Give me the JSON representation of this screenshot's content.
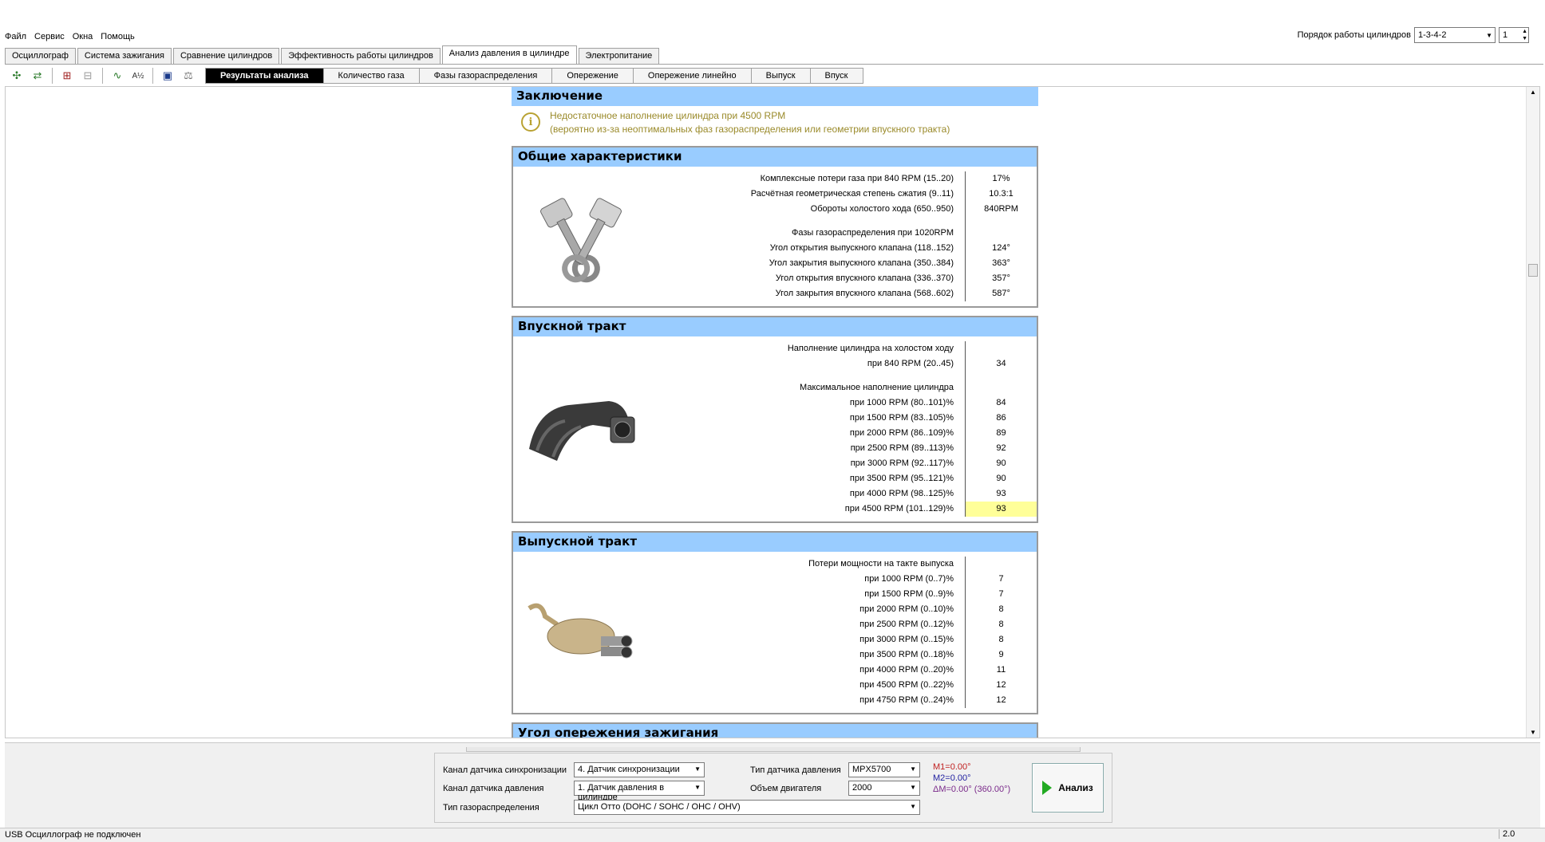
{
  "menu": [
    "Файл",
    "Сервис",
    "Окна",
    "Помощь"
  ],
  "cylinder_order": {
    "label": "Порядок работы цилиндров",
    "value": "1-3-4-2",
    "spinner": "1"
  },
  "tabs": [
    "Осциллограф",
    "Система зажигания",
    "Сравнение цилиндров",
    "Эффективность работы цилиндров",
    "Анализ давления в цилиндре",
    "Электропитание"
  ],
  "active_tab": "Анализ давления в цилиндре",
  "subtabs": [
    "Результаты анализа",
    "Количество газа",
    "Фазы газораспределения",
    "Опережение",
    "Опережение линейно",
    "Выпуск",
    "Впуск"
  ],
  "conclusion": {
    "title": "Заключение",
    "line1": "Недостаточное наполнение цилиндра при 4500 RPM",
    "line2": "(вероятно из-за неоптимальных фаз газораспределения или геометрии впускного тракта)"
  },
  "general": {
    "title": "Общие характеристики",
    "rows": [
      {
        "label": "Комплексные потери газа при 840 RPM (15..20)",
        "value": "17%"
      },
      {
        "label": "Расчётная геометрическая степень сжатия (9..11)",
        "value": "10.3:1"
      },
      {
        "label": "Обороты холостого хода (650..950)",
        "value": "840RPM"
      },
      {
        "label": "",
        "value": ""
      },
      {
        "label": "Фазы газораспределения при 1020RPM",
        "value": ""
      },
      {
        "label": "Угол открытия выпускного клапана (118..152)",
        "value": "124°"
      },
      {
        "label": "Угол закрытия выпускного клапана (350..384)",
        "value": "363°"
      },
      {
        "label": "Угол открытия впускного клапана (336..370)",
        "value": "357°"
      },
      {
        "label": "Угол закрытия впускного клапана (568..602)",
        "value": "587°"
      }
    ]
  },
  "intake": {
    "title": "Впускной тракт",
    "rows": [
      {
        "label": "Наполнение цилиндра на холостом ходу",
        "value": ""
      },
      {
        "label": "при 840 RPM (20..45)",
        "value": "34"
      },
      {
        "label": "",
        "value": ""
      },
      {
        "label": "Максимальное наполнение цилиндра",
        "value": ""
      },
      {
        "label": "при  1000 RPM (80..101)%",
        "value": "84"
      },
      {
        "label": "при  1500 RPM (83..105)%",
        "value": "86"
      },
      {
        "label": "при  2000 RPM (86..109)%",
        "value": "89"
      },
      {
        "label": "при  2500 RPM (89..113)%",
        "value": "92"
      },
      {
        "label": "при  3000 RPM (92..117)%",
        "value": "90"
      },
      {
        "label": "при  3500 RPM (95..121)%",
        "value": "90"
      },
      {
        "label": "при  4000 RPM (98..125)%",
        "value": "93"
      },
      {
        "label": "при  4500 RPM (101..129)%",
        "value": "93",
        "highlight": true
      }
    ]
  },
  "exhaust": {
    "title": "Выпускной тракт",
    "rows": [
      {
        "label": "Потери мощности на такте выпуска",
        "value": ""
      },
      {
        "label": "при  1000 RPM (0..7)%",
        "value": "7"
      },
      {
        "label": "при  1500 RPM (0..9)%",
        "value": "7"
      },
      {
        "label": "при  2000 RPM (0..10)%",
        "value": "8"
      },
      {
        "label": "при  2500 RPM (0..12)%",
        "value": "8"
      },
      {
        "label": "при  3000 RPM (0..15)%",
        "value": "8"
      },
      {
        "label": "при  3500 RPM (0..18)%",
        "value": "9"
      },
      {
        "label": "при  4000 RPM (0..20)%",
        "value": "11"
      },
      {
        "label": "при  4500 RPM (0..22)%",
        "value": "12"
      },
      {
        "label": "при  4750 RPM (0..24)%",
        "value": "12"
      }
    ]
  },
  "ignition": {
    "title": "Угол опережения зажигания"
  },
  "form": {
    "sync_label": "Канал датчика синхронизации",
    "sync_value": "4.  Датчик синхронизации",
    "pressure_label": "Канал датчика давления",
    "pressure_value": "1.  Датчик давления в цилиндре",
    "valve_label": "Тип газораспределения",
    "valve_value": "Цикл Отто (DOHC / SOHC / OHC / OHV)",
    "sensor_type_label": "Тип датчика давления",
    "sensor_type_value": "MPX5700",
    "volume_label": "Объем двигателя",
    "volume_value": "2000",
    "m1": "M1=0.00°",
    "m2": "M2=0.00°",
    "dm": "ΔM=0.00° (360.00°)",
    "analyze_label": "Анализ"
  },
  "status": {
    "left": "USB Осциллограф не подключен",
    "right": "2.0"
  },
  "colors": {
    "section_header": "#99ccff",
    "highlight": "#ffff99",
    "warning_text": "#9a8a2a"
  }
}
